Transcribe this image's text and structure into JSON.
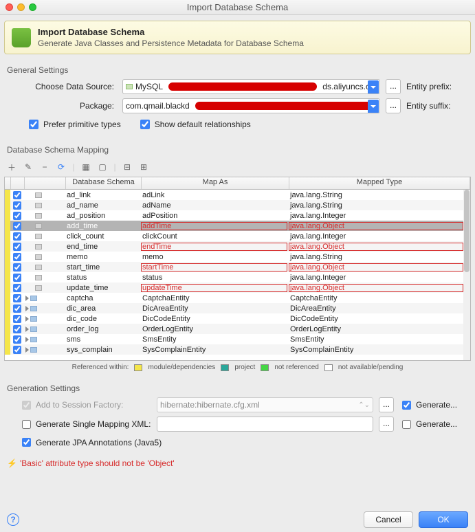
{
  "window": {
    "title": "Import Database Schema"
  },
  "header": {
    "title": "Import Database Schema",
    "subtitle": "Generate Java Classes and Persistence Metadata for Database Schema"
  },
  "general": {
    "section": "General Settings",
    "datasource_label": "Choose Data Source:",
    "datasource_prefix": "MySQL",
    "datasource_suffix": "ds.aliyuncs.c...",
    "package_label": "Package:",
    "package_prefix": "com.qmail.blackd",
    "entity_prefix_label": "Entity prefix:",
    "entity_suffix_label": "Entity suffix:",
    "prefer_primitive": "Prefer primitive types",
    "show_default_rel": "Show default relationships"
  },
  "mapping": {
    "section": "Database Schema Mapping",
    "columns": {
      "schema": "Database Schema",
      "map": "Map As",
      "type": "Mapped Type"
    },
    "rows": [
      {
        "name": "ad_link",
        "map": "adLink",
        "type": "java.lang.String",
        "icon": "col",
        "err": false
      },
      {
        "name": "ad_name",
        "map": "adName",
        "type": "java.lang.String",
        "icon": "col",
        "err": false
      },
      {
        "name": "ad_position",
        "map": "adPosition",
        "type": "java.lang.Integer",
        "icon": "col",
        "err": false
      },
      {
        "name": "add_time",
        "map": "addTime",
        "type": "java.lang.Object",
        "icon": "col",
        "err": true,
        "sel": true
      },
      {
        "name": "click_count",
        "map": "clickCount",
        "type": "java.lang.Integer",
        "icon": "col",
        "err": false
      },
      {
        "name": "end_time",
        "map": "endTime",
        "type": "java.lang.Object",
        "icon": "col",
        "err": true
      },
      {
        "name": "memo",
        "map": "memo",
        "type": "java.lang.String",
        "icon": "col",
        "err": false
      },
      {
        "name": "start_time",
        "map": "startTime",
        "type": "java.lang.Object",
        "icon": "col",
        "err": true
      },
      {
        "name": "status",
        "map": "status",
        "type": "java.lang.Integer",
        "icon": "col",
        "err": false
      },
      {
        "name": "update_time",
        "map": "updateTime",
        "type": "java.lang.Object",
        "icon": "col",
        "err": true
      },
      {
        "name": "captcha",
        "map": "CaptchaEntity",
        "type": "CaptchaEntity",
        "icon": "tbl",
        "tree": true
      },
      {
        "name": "dic_area",
        "map": "DicAreaEntity",
        "type": "DicAreaEntity",
        "icon": "tbl",
        "tree": true
      },
      {
        "name": "dic_code",
        "map": "DicCodeEntity",
        "type": "DicCodeEntity",
        "icon": "tbl",
        "tree": true
      },
      {
        "name": "order_log",
        "map": "OrderLogEntity",
        "type": "OrderLogEntity",
        "icon": "tbl",
        "tree": true
      },
      {
        "name": "sms",
        "map": "SmsEntity",
        "type": "SmsEntity",
        "icon": "tbl",
        "tree": true
      },
      {
        "name": "sys_complain",
        "map": "SysComplainEntity",
        "type": "SysComplainEntity",
        "icon": "tbl",
        "tree": true
      }
    ]
  },
  "legend": {
    "label": "Referenced within:",
    "module": "module/dependencies",
    "project": "project",
    "notref": "not referenced",
    "pending": "not available/pending"
  },
  "generation": {
    "section": "Generation Settings",
    "session_label": "Add to Session Factory:",
    "session_value": "hibernate:hibernate.cfg.xml",
    "single_label": "Generate Single Mapping XML:",
    "jpa_label": "Generate JPA Annotations (Java5)",
    "gen_right": "Generate..."
  },
  "warning": "'Basic' attribute type should not be 'Object'",
  "footer": {
    "cancel": "Cancel",
    "ok": "OK"
  }
}
